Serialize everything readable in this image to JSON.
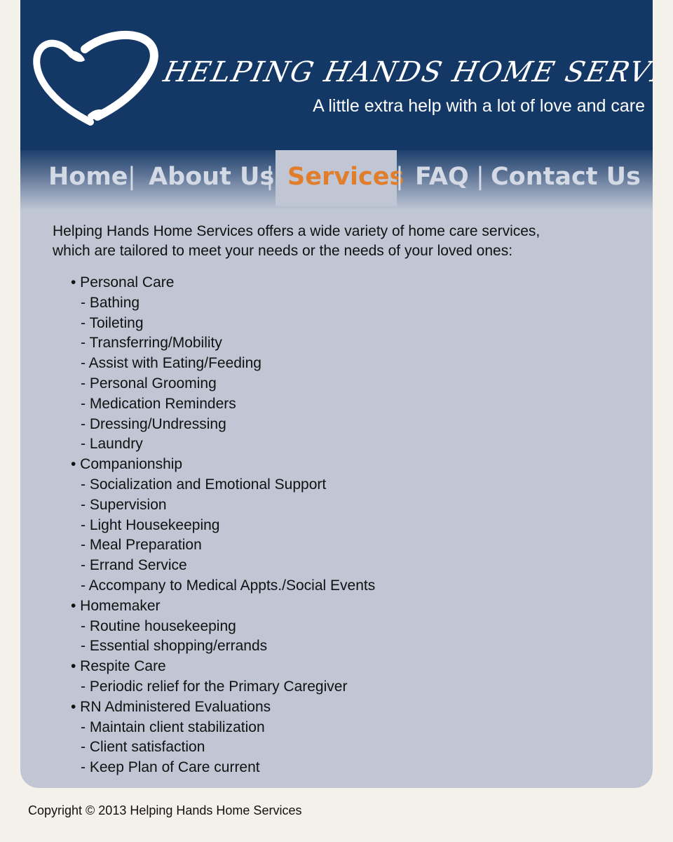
{
  "header": {
    "title": "HELPING HANDS HOME SERVICES",
    "tagline": "A little extra help with a lot of love and care",
    "logo_icon": "heart-hands-icon"
  },
  "nav": {
    "items": [
      {
        "label": "Home"
      },
      {
        "label": "About Us"
      },
      {
        "label": "Services",
        "active": true
      },
      {
        "label": "FAQ"
      },
      {
        "label": "Contact Us"
      }
    ],
    "separator": "|"
  },
  "main": {
    "intro_line1": "Helping Hands Home Services offers a wide variety of home care services,",
    "intro_line2": "which are tailored to meet your needs or the needs of your loved ones:",
    "services": [
      {
        "name": "• Personal Care",
        "items": [
          "- Bathing",
          "- Toileting",
          "- Transferring/Mobility",
          "- Assist with Eating/Feeding",
          "- Personal Grooming",
          "- Medication Reminders",
          "- Dressing/Undressing",
          "- Laundry"
        ]
      },
      {
        "name": "• Companionship",
        "items": [
          "- Socialization and Emotional Support",
          "- Supervision",
          "- Light Housekeeping",
          "- Meal Preparation",
          "- Errand Service",
          "- Accompany to Medical Appts./Social Events"
        ]
      },
      {
        "name": "• Homemaker",
        "items": [
          "- Routine housekeeping",
          "- Essential shopping/errands"
        ]
      },
      {
        "name": "• Respite Care",
        "items": [
          "- Periodic relief for the Primary Caregiver"
        ]
      },
      {
        "name": "• RN Administered Evaluations",
        "items": [
          "- Maintain client stabilization",
          "- Client satisfaction",
          "- Keep Plan of Care current"
        ]
      }
    ]
  },
  "footer": {
    "copyright": "Copyright © 2013 Helping Hands Home Services"
  },
  "colors": {
    "header_bg": "#133866",
    "panel_bg": "#c0c6d4",
    "nav_active": "#e07e2c",
    "nav_text": "#d3d9e5",
    "page_bg": "#f3f1ea"
  }
}
